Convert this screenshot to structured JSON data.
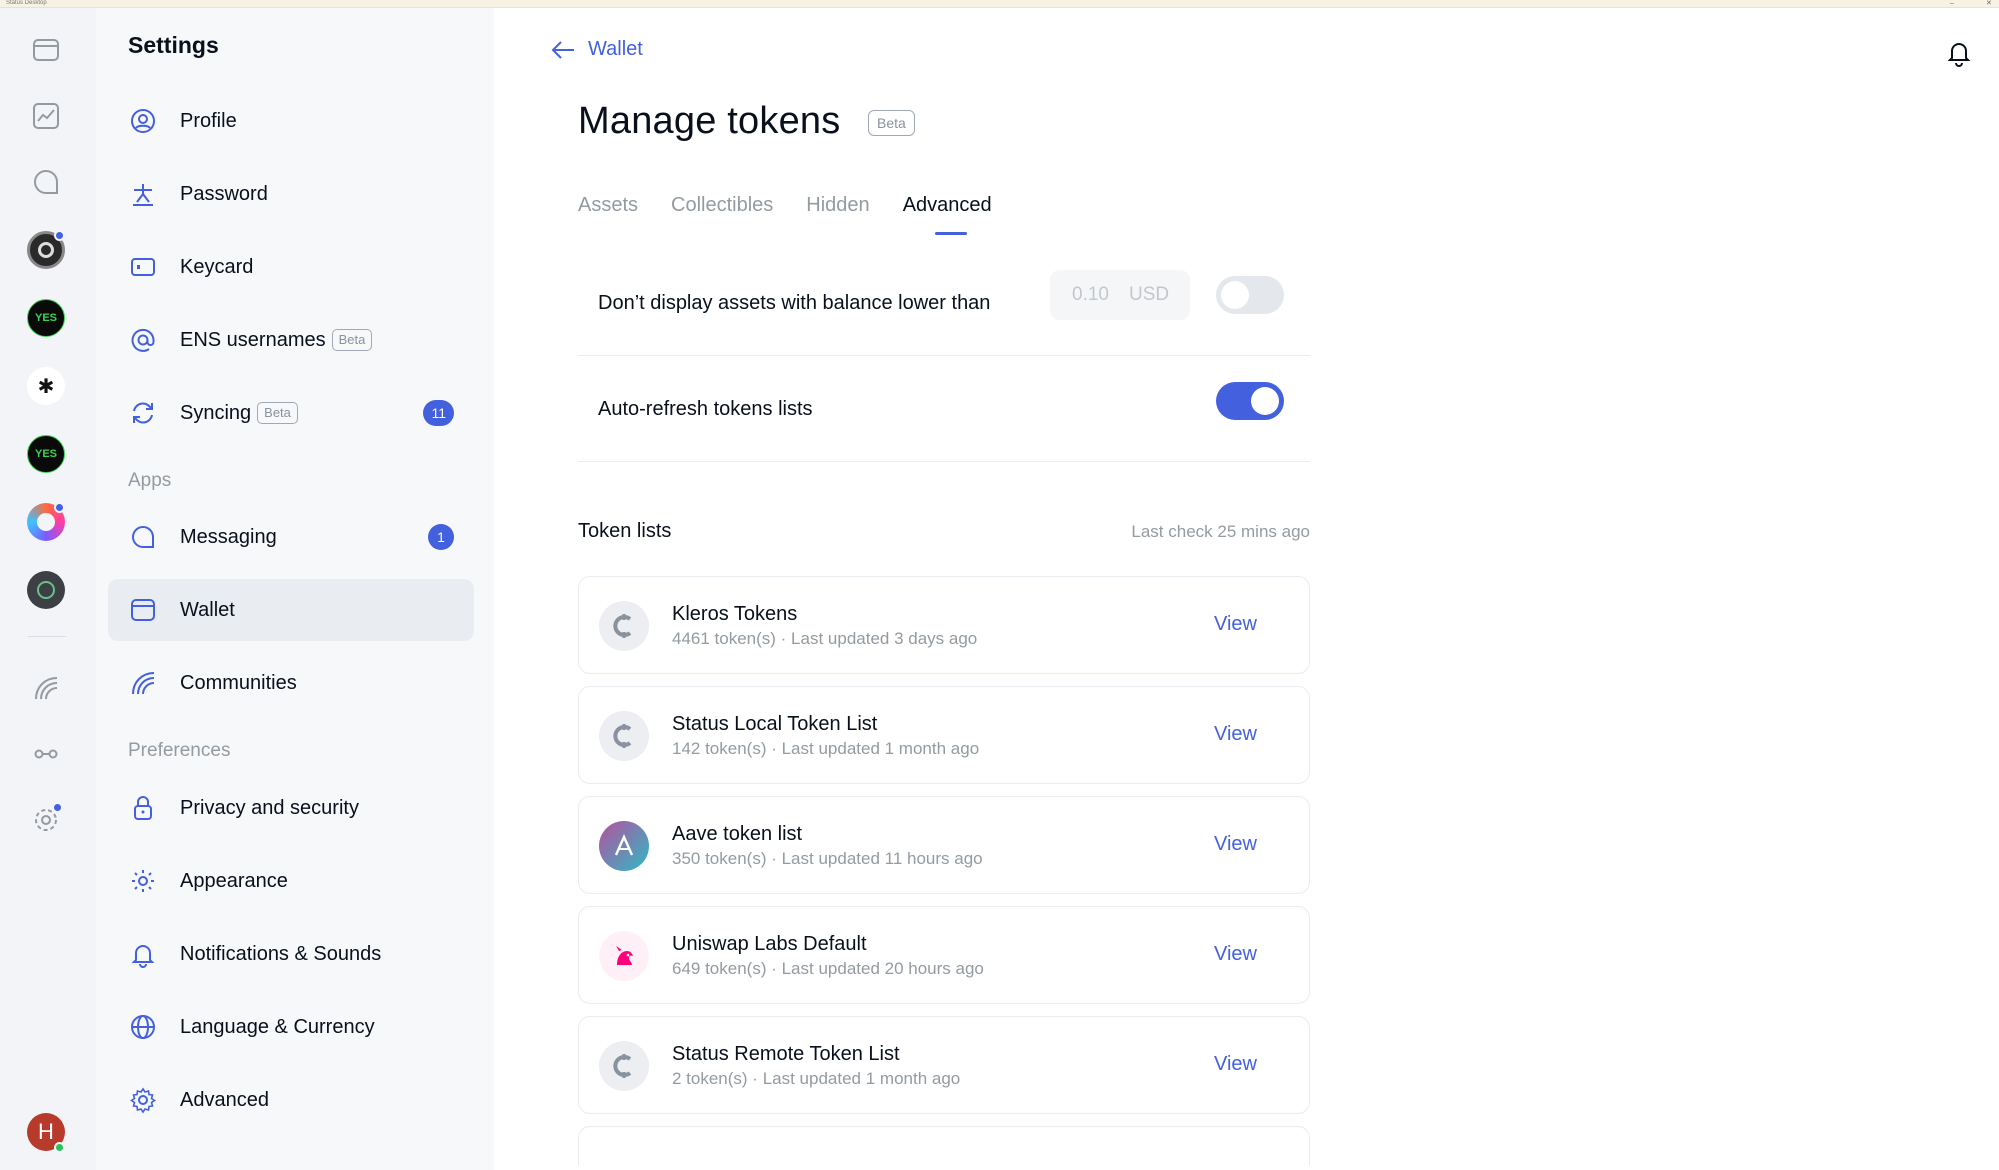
{
  "window": {
    "title": "Status Desktop",
    "controls": [
      "–",
      "✕"
    ]
  },
  "rail": {
    "communities": [
      {
        "name": "yes-community-1",
        "text": "YES",
        "bg": "#0a0a0a",
        "fg": "#39d353"
      },
      {
        "name": "star-community",
        "text": "✱",
        "bg": "#ffffff",
        "fg": "#111111"
      },
      {
        "name": "yes-community-2",
        "text": "YES",
        "bg": "#0a0a0a",
        "fg": "#39d353"
      }
    ],
    "avatar_letter": "H"
  },
  "sidebar": {
    "title": "Settings",
    "items": [
      {
        "label": "Profile"
      },
      {
        "label": "Password"
      },
      {
        "label": "Keycard"
      },
      {
        "label": "ENS usernames",
        "badge": "Beta"
      },
      {
        "label": "Syncing",
        "badge": "Beta",
        "count": "11"
      }
    ],
    "apps_section": "Apps",
    "apps": [
      {
        "label": "Messaging",
        "count": "1"
      },
      {
        "label": "Wallet"
      },
      {
        "label": "Communities"
      }
    ],
    "prefs_section": "Preferences",
    "prefs": [
      {
        "label": "Privacy and security"
      },
      {
        "label": "Appearance"
      },
      {
        "label": "Notifications & Sounds"
      },
      {
        "label": "Language & Currency"
      },
      {
        "label": "Advanced"
      }
    ]
  },
  "main": {
    "back_label": "Wallet",
    "title": "Manage tokens",
    "title_badge": "Beta",
    "tabs": [
      "Assets",
      "Collectibles",
      "Hidden",
      "Advanced"
    ],
    "active_tab": "Advanced",
    "settings": {
      "min_balance_label": "Don’t display assets with balance lower than",
      "min_balance_value": "0.10",
      "min_balance_currency": "USD",
      "min_balance_enabled": false,
      "auto_refresh_label": "Auto-refresh tokens lists",
      "auto_refresh_enabled": true
    },
    "token_lists_heading": "Token lists",
    "last_check": "Last check 25 mins ago",
    "view_label": "View",
    "lists": [
      {
        "name": "Kleros Tokens",
        "meta": "4461 token(s) · Last updated 3 days ago",
        "logo": "status-logo"
      },
      {
        "name": "Status Local Token List",
        "meta": "142 token(s) · Last updated 1 month ago",
        "logo": "status-logo"
      },
      {
        "name": "Aave token list",
        "meta": "350 token(s) · Last updated 11 hours ago",
        "logo": "aave-logo"
      },
      {
        "name": "Uniswap Labs Default",
        "meta": "649 token(s) · Last updated 20 hours ago",
        "logo": "uniswap-logo"
      },
      {
        "name": "Status Remote Token List",
        "meta": "2 token(s) · Last updated 1 month ago",
        "logo": "status-logo"
      }
    ]
  },
  "colors": {
    "accent": "#4360df",
    "muted": "#939ba1",
    "text": "#09101c"
  }
}
